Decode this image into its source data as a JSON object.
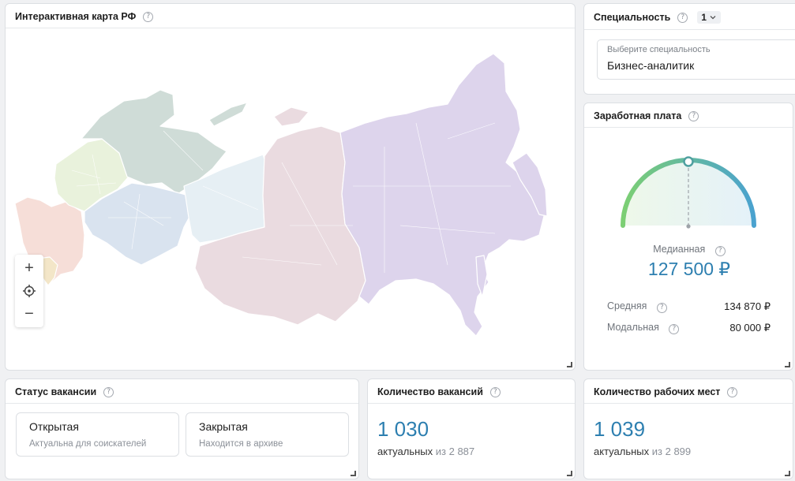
{
  "map": {
    "title": "Интерактивная карта РФ",
    "zoom_in_icon": "plus-icon",
    "locate_icon": "crosshair-icon",
    "zoom_out_icon": "minus-icon",
    "region_colors": [
      "#f6ded8",
      "#e9f2dc",
      "#cfdcd7",
      "#d9e3ef",
      "#e6eff4",
      "#eadbe0",
      "#ddd4ec"
    ]
  },
  "specialty": {
    "title": "Специальность",
    "count": "1",
    "placeholder": "Выберите специальность",
    "value": "Бизнес-аналитик"
  },
  "salary": {
    "title": "Заработная плата",
    "median_label": "Медианная",
    "median_value": "127 500 ₽",
    "gauge_fraction": 0.5,
    "average_label": "Средняя",
    "average_value": "134 870 ₽",
    "modal_label": "Модальная",
    "modal_value": "80 000 ₽"
  },
  "status": {
    "title": "Статус вакансии",
    "open_label": "Открытая",
    "open_desc": "Актуальна для соискателей",
    "closed_label": "Закрытая",
    "closed_desc": "Находится в архиве"
  },
  "vacancies": {
    "title": "Количество вакансий",
    "value": "1 030",
    "actual": "актуальных",
    "of_total": "из 2 887"
  },
  "workplaces": {
    "title": "Количество рабочих мест",
    "value": "1 039",
    "actual": "актуальных",
    "of_total": "из 2 899"
  },
  "colors": {
    "accent": "#2d7fb0",
    "gauge_start": "#7ccf73",
    "gauge_end": "#4aa2cf"
  }
}
